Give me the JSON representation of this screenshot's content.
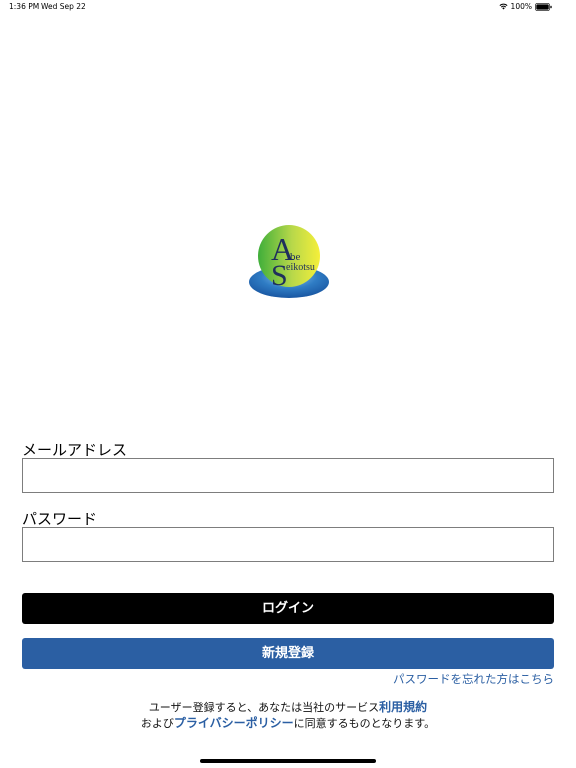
{
  "status_bar": {
    "time": "1:36 PM",
    "date": "Wed Sep 22",
    "battery": "100%",
    "icons": [
      "wifi-icon",
      "battery-icon"
    ]
  },
  "logo": {
    "text": "Abe Seikotsu",
    "colors": {
      "green": "#3fae3a",
      "yellow": "#f5ef3a",
      "blue": "#1e5fae",
      "navy": "#1f2f5c"
    }
  },
  "form": {
    "email_label": "メールアドレス",
    "email_value": "",
    "password_label": "パスワード",
    "password_value": "",
    "login_button": "ログイン",
    "register_button": "新規登録",
    "forgot_password": "パスワードを忘れた方はこちら"
  },
  "terms": {
    "line1_prefix": "ユーザー登録すると、あなたは当社のサービス",
    "terms_link": "利用規約",
    "line2_prefix": "および",
    "privacy_link": "プライバシーポリシー",
    "line2_suffix": "に同意するものとなります。"
  },
  "colors": {
    "login_bg": "#000000",
    "register_bg": "#2b5fa3",
    "link": "#2b5fa3"
  }
}
